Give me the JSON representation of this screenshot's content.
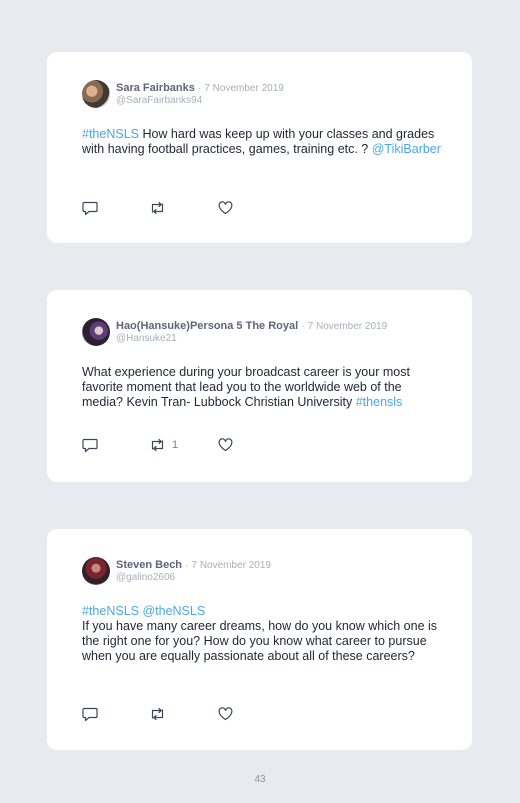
{
  "tweets": [
    {
      "name": "Sara Fairbanks",
      "separator": "·",
      "date": "7 November 2019",
      "handle": "@SaraFairbanks94",
      "text": [
        {
          "kind": "link",
          "value": "#theNSLS"
        },
        {
          "kind": "text",
          "value": " How hard was keep up with your classes and grades with having football practices, games, training etc. ? "
        },
        {
          "kind": "link",
          "value": "@TikiBarber"
        }
      ],
      "retweet_count": ""
    },
    {
      "name": "Hao(Hansuke)Persona 5 The Royal",
      "separator": "·",
      "date": "7 November 2019",
      "handle": "@Hansuke21",
      "text": [
        {
          "kind": "text",
          "value": "What experience during your broadcast career is your most favorite moment that lead you to the worldwide web of the media? Kevin Tran- Lubbock Christian University "
        },
        {
          "kind": "link",
          "value": "#thensls"
        }
      ],
      "retweet_count": "1"
    },
    {
      "name": "Steven Bech",
      "separator": "·",
      "date": "7 November 2019",
      "handle": "@galino2606",
      "text": [
        {
          "kind": "link",
          "value": "#theNSLS @theNSLS"
        },
        {
          "kind": "break",
          "value": ""
        },
        {
          "kind": "text",
          "value": "If you have many career dreams, how do you know which one is the right one for you? How do you know what career to pursue when you are equally passionate about all of these careers?"
        }
      ],
      "retweet_count": ""
    }
  ],
  "icons": {
    "reply": "reply-icon",
    "retweet": "retweet-icon",
    "like": "heart-icon"
  },
  "colors": {
    "background": "#e9eaef",
    "card": "#ffffff",
    "link": "#4aa8e6",
    "name": "#5c6678",
    "muted": "#a8afba"
  },
  "page_number": "43"
}
